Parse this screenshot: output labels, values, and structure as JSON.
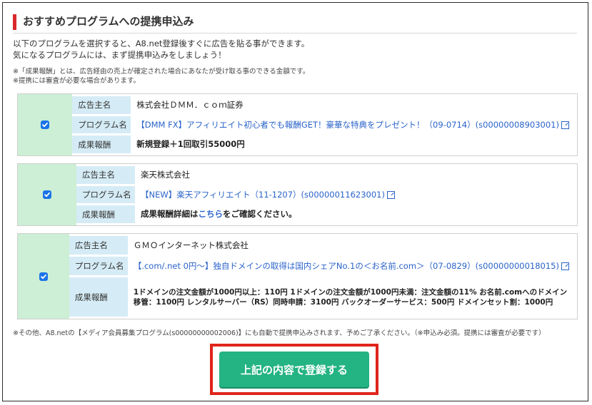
{
  "header": {
    "title": "おすすめプログラムへの提携申込み"
  },
  "intro": {
    "line1": "以下のプログラムを選択すると、A8.net登録後すぐに広告を貼る事ができます。",
    "line2": "気になるプログラムには、まず提携申込みをしましょう！"
  },
  "notes": {
    "line1": "※「成果報酬」とは、広告経由の売上が確定された場合にあなたが受け取る事のできる金額です。",
    "line2": "※提携には審査が必要な場合があります。"
  },
  "labels": {
    "advertiser": "広告主名",
    "program": "プログラム名",
    "reward": "成果報酬"
  },
  "programs": [
    {
      "checked": true,
      "advertiser": "株式会社ＤＭＭ．ｃｏｍ証券",
      "program": "【DMM FX】アフィリエイト初心者でも報酬GET！豪華な特典をプレゼント！（09-0714）(s00000008903001)",
      "reward": "新規登録＋1回取引55000円"
    },
    {
      "checked": true,
      "advertiser": "楽天株式会社",
      "program": "【NEW】楽天アフィリエイト（11-1207）(s00000011623001)",
      "reward_prefix": "成果報酬詳細は",
      "reward_link": "こちら",
      "reward_suffix": "をご確認ください。"
    },
    {
      "checked": true,
      "advertiser": "ＧＭＯインターネット株式会社",
      "program": "【.com/.net 0円〜】独自ドメインの取得は国内シェアNo.1の＜お名前.com＞（07-0829）(s00000000018015)",
      "reward": "1ドメインの注文金額が1000円以上：110円 1ドメインの注文金額が1000円未満：注文金額の11% お名前.comへのドメイン移管：1100円 レンタルサーバー（RS）同時申請：3100円 バックオーダーサービス：500円 ドメインセット割：1000円"
    }
  ],
  "footnote": "※その他、A8.netの【メディア会員募集プログラム(s00000000002006)】にも自動で提携申込みされます、予めご了承ください。（※申込み必須。提携には審査が必要です）",
  "submit": {
    "label": "上記の内容で登録する"
  },
  "colors": {
    "accent_red": "#d9292b",
    "button": "#24b383",
    "check_bg": "#ccefd5",
    "label_bg": "#d5ecf6",
    "link": "#2a63c9"
  }
}
